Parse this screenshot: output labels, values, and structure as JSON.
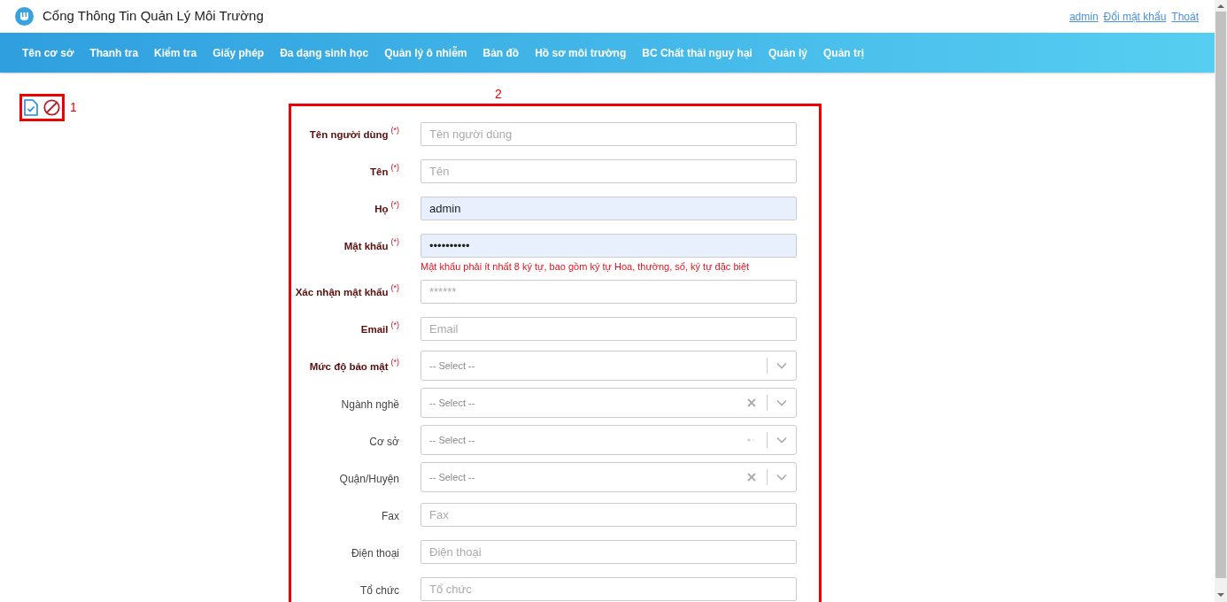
{
  "header": {
    "title": "Cổng Thông Tin Quản Lý Môi Trường",
    "links": [
      "admin",
      "Đổi mật khẩu",
      "Thoát"
    ]
  },
  "nav": [
    "Tên cơ sở",
    "Thanh tra",
    "Kiểm tra",
    "Giấy phép",
    "Đa dạng sinh học",
    "Quản lý ô nhiễm",
    "Bản đồ",
    "Hồ sơ môi trường",
    "BC Chất thải nguy hại",
    "Quản lý",
    "Quản trị"
  ],
  "annotations": [
    {
      "label": "1"
    },
    {
      "label": "2"
    }
  ],
  "form": {
    "required_mark": "(*)",
    "fields": [
      {
        "kind": "input",
        "label": "Tên người dùng",
        "required": true,
        "placeholder": "Tên người dùng",
        "autofilled": false
      },
      {
        "kind": "input",
        "label": "Tên",
        "required": true,
        "placeholder": "Tên",
        "autofilled": false
      },
      {
        "kind": "input",
        "label": "Họ",
        "required": true,
        "value": "admin",
        "autofilled": true
      },
      {
        "kind": "input",
        "label": "Mật khẩu",
        "required": true,
        "value": "••••••••••",
        "autofilled": true,
        "hint": "Mật khẩu phải ít nhất 8 ký tự, bao gồm ký tự Hoa, thường, số, ký tự đặc biệt"
      },
      {
        "kind": "input",
        "label": "Xác nhận mật khẩu",
        "required": true,
        "placeholder": "******",
        "autofilled": false
      },
      {
        "kind": "input",
        "label": "Email",
        "required": true,
        "placeholder": "Email",
        "autofilled": false
      },
      {
        "kind": "select",
        "label": "Mức độ bảo mật",
        "required": true,
        "placeholder": "-- Select --",
        "clearable": false,
        "loading": false
      },
      {
        "kind": "select",
        "label": "Ngành nghề",
        "required": false,
        "placeholder": "-- Select --",
        "clearable": true,
        "loading": false
      },
      {
        "kind": "select",
        "label": "Cơ sở",
        "required": false,
        "placeholder": "-- Select --",
        "clearable": false,
        "loading": true
      },
      {
        "kind": "select",
        "label": "Quận/Huyện",
        "required": false,
        "placeholder": "-- Select --",
        "clearable": true,
        "loading": false
      },
      {
        "kind": "input",
        "label": "Fax",
        "required": false,
        "placeholder": "Fax",
        "autofilled": false
      },
      {
        "kind": "input",
        "label": "Điện thoại",
        "required": false,
        "placeholder": "Điện thoại",
        "autofilled": false
      },
      {
        "kind": "input",
        "label": "Tổ chức",
        "required": false,
        "placeholder": "Tổ chức",
        "autofilled": false
      }
    ]
  }
}
